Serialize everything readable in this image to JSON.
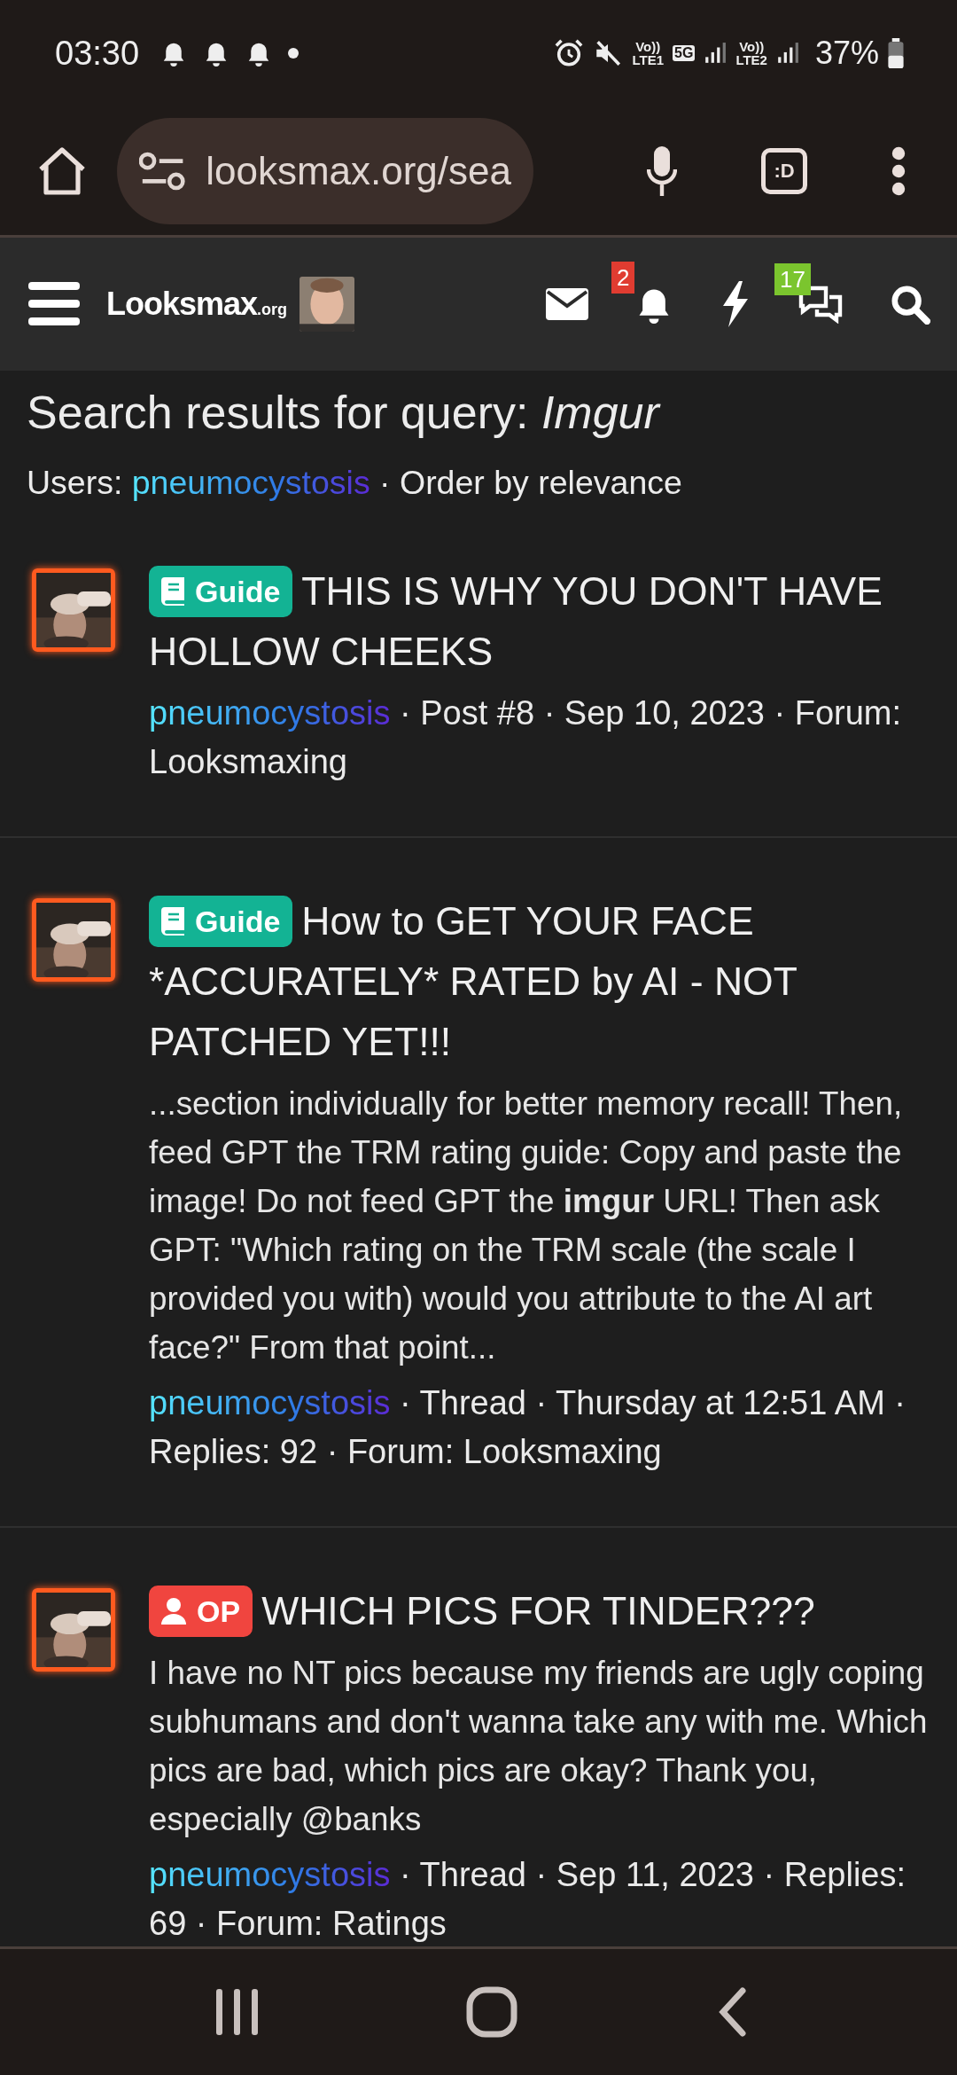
{
  "status_bar": {
    "time": "03:30",
    "sim_1": {
      "top": "Vo))",
      "bottom": "LTE1"
    },
    "network": "5G",
    "sim_2": {
      "top": "Vo))",
      "bottom": "LTE2"
    },
    "battery": "37%"
  },
  "browser": {
    "url": "looksmax.org/sea",
    "tabs_button": ":D"
  },
  "site_nav": {
    "logo": "Looksmax",
    "logo_suffix": ".org",
    "alerts_badge": "2",
    "conversations_badge": "17"
  },
  "search": {
    "title": "Search results for query: *Imgur*",
    "users_label": "Users:",
    "user": "pneumocystosis",
    "order": "· Order by relevance"
  },
  "results": [
    {
      "label": {
        "kind": "guide",
        "text": "Guide"
      },
      "title": "THIS IS WHY YOU DON'T HAVE HOLLOW CHEEKS",
      "author": "pneumocystosis",
      "meta": "· Post #8 · Sep 10, 2023 · Forum: Looksmaxing"
    },
    {
      "label": {
        "kind": "guide",
        "text": "Guide"
      },
      "title": "How to GET YOUR FACE *ACCURATELY* RATED by AI - NOT PATCHED YET!!!",
      "snippet": "...section individually for better memory recall! Then, feed GPT the TRM rating guide: Copy and paste the image! Do not feed GPT the **imgur** URL! Then ask GPT: \"Which rating on the TRM scale (the scale I provided you with) would you attribute to the AI art face?\" From that point...",
      "author": "pneumocystosis",
      "meta": "· Thread · Thursday at 12:51 AM · Replies: 92 · Forum: Looksmaxing"
    },
    {
      "label": {
        "kind": "op",
        "text": "OP"
      },
      "title": "WHICH PICS FOR TINDER???",
      "snippet": "I have no NT pics because my friends are ugly coping subhumans and don't wanna take any with me. Which pics are bad, which pics are okay? Thank you, especially @banks",
      "author": "pneumocystosis",
      "meta": "· Thread · Sep 11, 2023 · Replies: 69 · Forum: Ratings"
    }
  ]
}
